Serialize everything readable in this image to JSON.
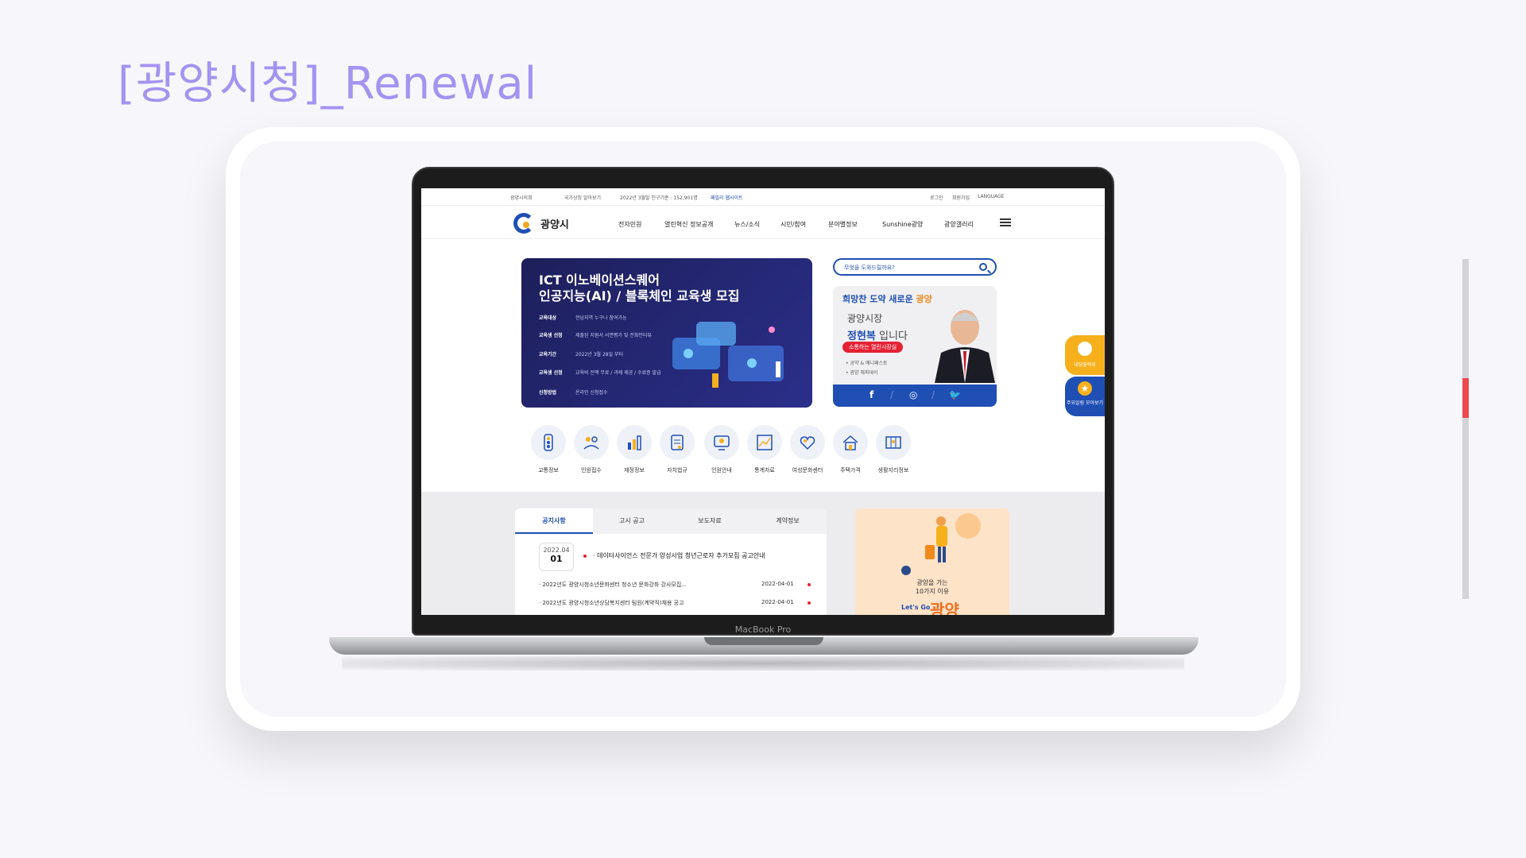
{
  "heading": "[광양시청]_Renewal",
  "laptop_label": "MacBook Pro",
  "utility": {
    "council": "광양시의회",
    "national_site": "국가상징 알아보기",
    "population": "2022년 3월말 인구기준 : 152,901명",
    "family_sites": "패밀리 웹사이트",
    "login": "로그인",
    "signup": "회원가입",
    "language": "LANGUAGE"
  },
  "logo_text": "광양시",
  "menu": [
    "전자민원",
    "열린혁신 정보공개",
    "뉴스/소식",
    "시민/참여",
    "분야별정보",
    "Sunshine광양",
    "광양갤러리"
  ],
  "banner": {
    "title1": "ICT 이노베이션스퀘어",
    "title2": "인공지능(AI) / 블록체인 교육생 모집",
    "rows": [
      {
        "k": "교육대상",
        "v": "전남지역 누구나 참여가능"
      },
      {
        "k": "교육생 선정",
        "v": "제출된 지원서 서면평가 및 전화인터뷰"
      },
      {
        "k": "교육기간",
        "v": "2022년 3월 28일 부터"
      },
      {
        "k": "교육생 선정",
        "v": "교육비 전액 무료 / 과제 제공 / 수료증 발급"
      },
      {
        "k": "신청방법",
        "v": "온라인 신청접수"
      }
    ]
  },
  "search": {
    "placeholder": "무엇을 도와드릴까요?"
  },
  "mayor": {
    "slogan_a": "희망찬 ",
    "slogan_b": "도약",
    "slogan_c": " 새로운 ",
    "slogan_d": "광양",
    "title": "광양시장",
    "name": "정현복",
    "name_suffix": " 입니다",
    "badge": "소통하는 열린시장실",
    "links": [
      "• 공약 & 매니페스토",
      "• 광양 해피데이"
    ],
    "sns": [
      "f",
      "◎",
      "🐦"
    ]
  },
  "quick_icons": [
    {
      "label": "교통정보",
      "icon": "traffic-light-icon"
    },
    {
      "label": "인원접수",
      "icon": "people-hands-icon"
    },
    {
      "label": "재정정보",
      "icon": "finance-chart-icon"
    },
    {
      "label": "자치법규",
      "icon": "law-document-icon"
    },
    {
      "label": "인원안내",
      "icon": "info-monitor-icon"
    },
    {
      "label": "통계자료",
      "icon": "statistics-chart-icon"
    },
    {
      "label": "여성문화센터",
      "icon": "heart-icon"
    },
    {
      "label": "주택가격",
      "icon": "house-icon"
    },
    {
      "label": "생활지리정보",
      "icon": "map-icon"
    }
  ],
  "notice": {
    "tabs": [
      "공지사항",
      "고시 공고",
      "보도자료",
      "계약정보"
    ],
    "active_tab": 0,
    "date_ym": "2022.04",
    "date_d": "01",
    "headline": "· 데이터사이언스 전문가 양성사업 청년근로자 추가모집 공고안내",
    "rows": [
      {
        "title": "· 2022년도 광양시청소년문화센터 청소년 문화강좌 강사모집...",
        "date": "2022-04-01"
      },
      {
        "title": "· 2022년도 광양시청소년상담복지센터 팀원(계약직)채용 공고",
        "date": "2022-04-01"
      }
    ]
  },
  "promo": {
    "line1": "광양을 가는",
    "line2": "10가지 이유",
    "lets": "Let's Go",
    "big": "광양"
  },
  "float_buttons": [
    "내당출혁위",
    "주요알림 모아보기"
  ],
  "colors": {
    "accent": "#1f4fb3",
    "heading": "#a493f0",
    "alert": "#e52234",
    "orange": "#f5b01c"
  },
  "scroll_position": 0.35
}
